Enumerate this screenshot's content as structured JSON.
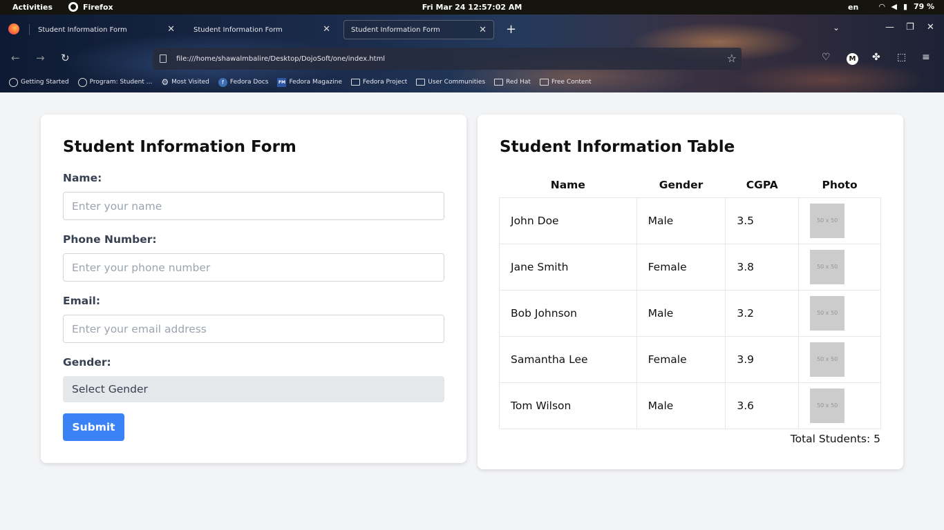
{
  "system": {
    "activities": "Activities",
    "app": "Firefox",
    "clock": "Fri Mar 24  12:57:02 AM",
    "lang": "en",
    "battery": "79 %"
  },
  "browser": {
    "tabs": [
      {
        "title": "Student Information Form"
      },
      {
        "title": "Student Information Form"
      },
      {
        "title": "Student Information Form"
      }
    ],
    "url": "file:///home/shawalmbalire/Desktop/DojoSoft/one/index.html",
    "bookmarks": [
      {
        "label": "Getting Started",
        "icon": "globe-icon"
      },
      {
        "label": "Program: Student ...",
        "icon": "globe-icon"
      },
      {
        "label": "Most Visited",
        "icon": "gear-icon"
      },
      {
        "label": "Fedora Docs",
        "icon": "fedora-icon"
      },
      {
        "label": "Fedora Magazine",
        "icon": "fm-icon"
      },
      {
        "label": "Fedora Project",
        "icon": "folder-icon"
      },
      {
        "label": "User Communities",
        "icon": "folder-icon"
      },
      {
        "label": "Red Hat",
        "icon": "folder-icon"
      },
      {
        "label": "Free Content",
        "icon": "folder-icon"
      }
    ]
  },
  "form": {
    "title": "Student Information Form",
    "name_label": "Name:",
    "name_placeholder": "Enter your name",
    "phone_label": "Phone Number:",
    "phone_placeholder": "Enter your phone number",
    "email_label": "Email:",
    "email_placeholder": "Enter your email address",
    "gender_label": "Gender:",
    "gender_value": "Select Gender",
    "submit_label": "Submit"
  },
  "table": {
    "title": "Student Information Table",
    "headers": [
      "Name",
      "Gender",
      "CGPA",
      "Photo"
    ],
    "rows": [
      {
        "name": "John Doe",
        "gender": "Male",
        "cgpa": "3.5",
        "photo": "50 x 50"
      },
      {
        "name": "Jane Smith",
        "gender": "Female",
        "cgpa": "3.8",
        "photo": "50 x 50"
      },
      {
        "name": "Bob Johnson",
        "gender": "Male",
        "cgpa": "3.2",
        "photo": "50 x 50"
      },
      {
        "name": "Samantha Lee",
        "gender": "Female",
        "cgpa": "3.9",
        "photo": "50 x 50"
      },
      {
        "name": "Tom Wilson",
        "gender": "Male",
        "cgpa": "3.6",
        "photo": "50 x 50"
      }
    ],
    "total": "Total Students: 5"
  },
  "colors": {
    "accent": "#3b82f6",
    "page_bg": "#f3f4f6",
    "topbar": "#15140e"
  }
}
